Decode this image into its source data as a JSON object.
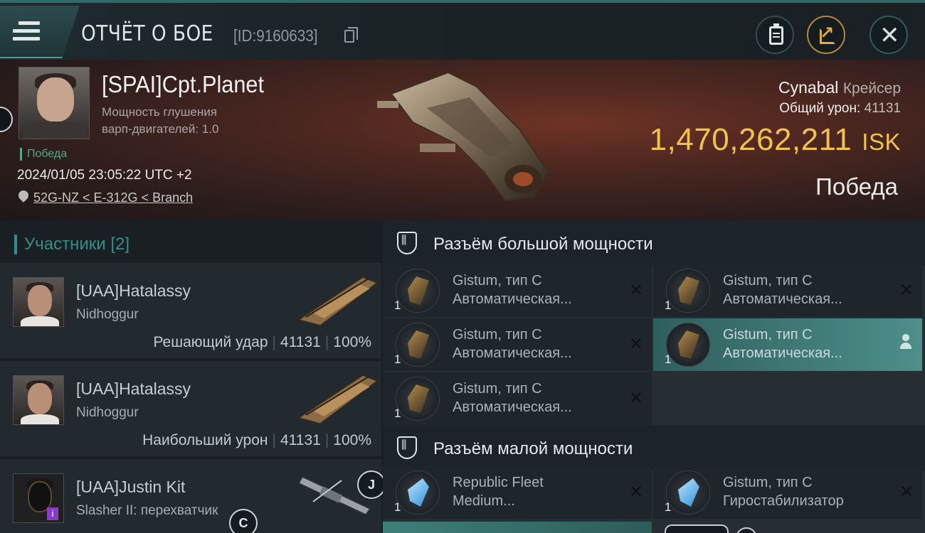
{
  "header": {
    "title": "ОТЧЁТ О БОЕ",
    "report_id": "[ID:9160633]",
    "icons": {
      "menu": "hamburger-icon",
      "copy": "copy-icon",
      "clipboard": "clipboard-icon",
      "share": "share-icon",
      "close": "close-icon"
    }
  },
  "victim": {
    "name": "[SPAI]Cpt.Planet",
    "warp_line1": "Мощность глушения",
    "warp_line2": "варп-двигателей: 1.0",
    "status": "Победа",
    "datetime": "2024/01/05 23:05:22 UTC +2",
    "location": "52G-NZ < E-312G < Branch",
    "ship_name": "Cynabal",
    "ship_class": "Крейсер",
    "total_damage_label": "Общий урон:",
    "total_damage": "41131",
    "isk_value": "1,470,262,211",
    "isk_unit": "ISK",
    "result": "Победа"
  },
  "participants": {
    "label": "Участники",
    "count": "[2]",
    "rows": [
      {
        "name": "[UAA]Hatalassy",
        "ship": "Nidhoggur",
        "role": "Решающий удар",
        "damage": "41131",
        "percent": "100%"
      },
      {
        "name": "[UAA]Hatalassy",
        "ship": "Nidhoggur",
        "role": "Наибольший урон",
        "damage": "41131",
        "percent": "100%"
      },
      {
        "name": "[UAA]Justin Kit",
        "ship": "Slasher II: перехватчик"
      }
    ],
    "badges": {
      "j": "J",
      "c": "C",
      "i": "i"
    }
  },
  "slots": {
    "high": {
      "title": "Разъём большой мощности",
      "modules": [
        {
          "qty": "1",
          "line1": "Gistum, тип C",
          "line2": "Автоматическая...",
          "action": "✕"
        },
        {
          "qty": "1",
          "line1": "Gistum, тип C",
          "line2": "Автоматическая...",
          "action": "✕"
        },
        {
          "qty": "1",
          "line1": "Gistum, тип C",
          "line2": "Автоматическая...",
          "action": "✕"
        },
        {
          "qty": "1",
          "line1": "Gistum, тип C",
          "line2": "Автоматическая...",
          "action": "user"
        },
        {
          "qty": "1",
          "line1": "Gistum, тип C",
          "line2": "Автоматическая...",
          "action": "✕"
        }
      ]
    },
    "low": {
      "title": "Разъём малой мощности",
      "modules": [
        {
          "qty": "1",
          "line1": "Republic Fleet",
          "line2": "Medium...",
          "action": "✕"
        },
        {
          "qty": "1",
          "line1": "Gistum, тип C",
          "line2": "Гиростабилизатор",
          "action": "✕"
        }
      ]
    }
  },
  "colors": {
    "accent_teal": "#2f8f8a",
    "isk_gold": "#f2c24d",
    "victory_green": "#5aa58a"
  }
}
